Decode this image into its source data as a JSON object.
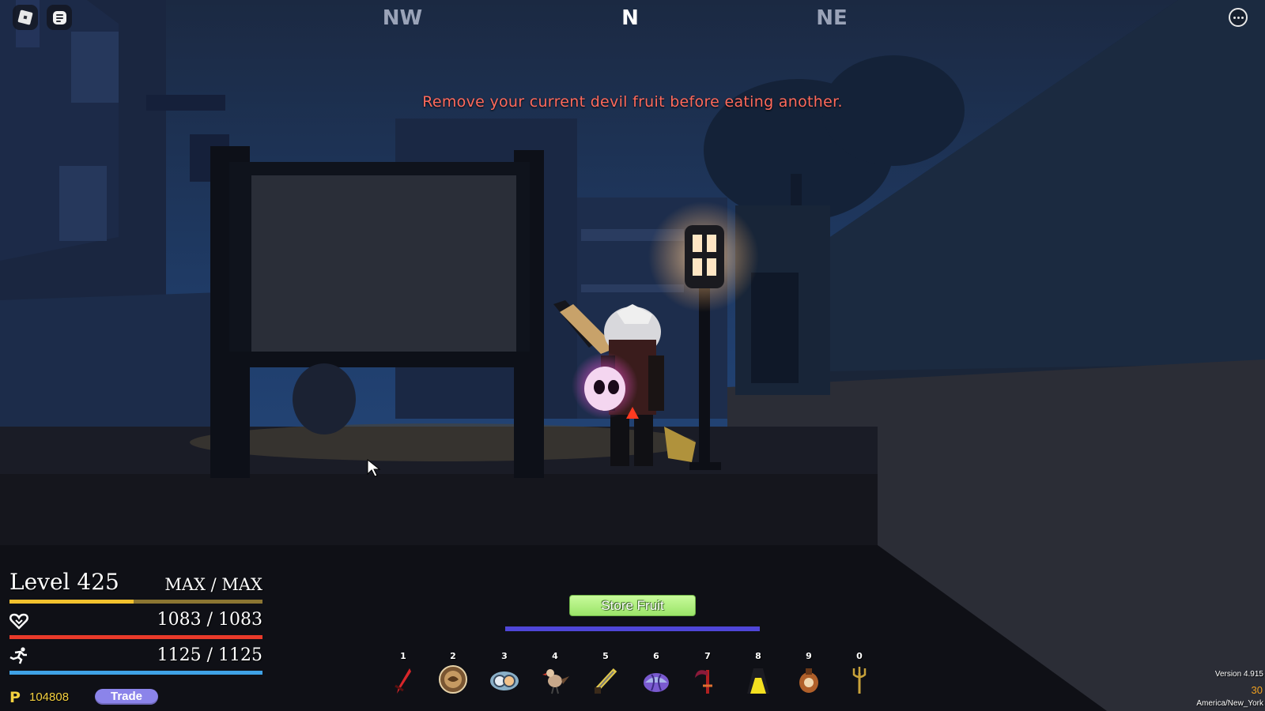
{
  "topbar": {
    "roblox_menu_icon": "roblox-logo-icon",
    "chat_icon": "chat-icon",
    "more_icon": "ellipsis-icon"
  },
  "compass": {
    "left": "NW",
    "center": "N",
    "right": "NE",
    "center_color": "#ffffff",
    "side_color": "#9aa3b8"
  },
  "notification": "Remove your current devil fruit before eating another.",
  "stats": {
    "level_label": "Level 425",
    "xp_text": "MAX / MAX",
    "xp_fill_fraction": 0.49,
    "health_text": "1083 / 1083",
    "health_fill_fraction": 1.0,
    "energy_text": "1125 / 1125",
    "energy_fill_fraction": 1.0,
    "health_icon": "heart-icon",
    "energy_icon": "running-icon"
  },
  "currency": {
    "icon": "beli-icon",
    "symbol": "P",
    "amount": "104808"
  },
  "trade_label": "Trade",
  "store_fruit_label": "Store Fruit",
  "hotbar": [
    {
      "key": "1",
      "icon": "red-sword-icon"
    },
    {
      "key": "2",
      "icon": "fighting-style-icon"
    },
    {
      "key": "3",
      "icon": "devil-fruit-icon"
    },
    {
      "key": "4",
      "icon": "bird-icon"
    },
    {
      "key": "5",
      "icon": "blade-icon"
    },
    {
      "key": "6",
      "icon": "purple-fruit-icon"
    },
    {
      "key": "7",
      "icon": "scythe-icon"
    },
    {
      "key": "8",
      "icon": "cloak-icon"
    },
    {
      "key": "9",
      "icon": "potion-icon"
    },
    {
      "key": "0",
      "icon": "trident-icon"
    }
  ],
  "footer": {
    "version": "Version 4.915",
    "fps": "30",
    "timezone": "America/New_York"
  }
}
